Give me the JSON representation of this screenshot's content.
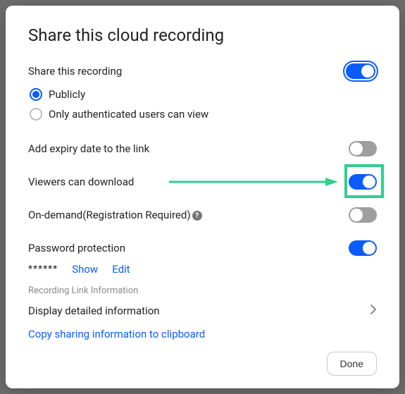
{
  "title": "Share this cloud recording",
  "share": {
    "label": "Share this recording",
    "options": {
      "public": "Publicly",
      "auth": "Only authenticated users can view"
    },
    "selected": "public",
    "enabled": true
  },
  "expiry": {
    "label": "Add expiry date to the link",
    "enabled": false
  },
  "download": {
    "label": "Viewers can download",
    "enabled": true,
    "highlighted": true
  },
  "ondemand": {
    "label": "On-demand(Registration Required)",
    "enabled": false
  },
  "password": {
    "label": "Password protection",
    "enabled": true,
    "mask": "******",
    "show": "Show",
    "edit": "Edit"
  },
  "link_info": {
    "heading": "Recording Link Information",
    "detail": "Display detailed information",
    "copy": "Copy sharing information to clipboard"
  },
  "footer": {
    "done": "Done"
  },
  "help_icon_char": "?"
}
